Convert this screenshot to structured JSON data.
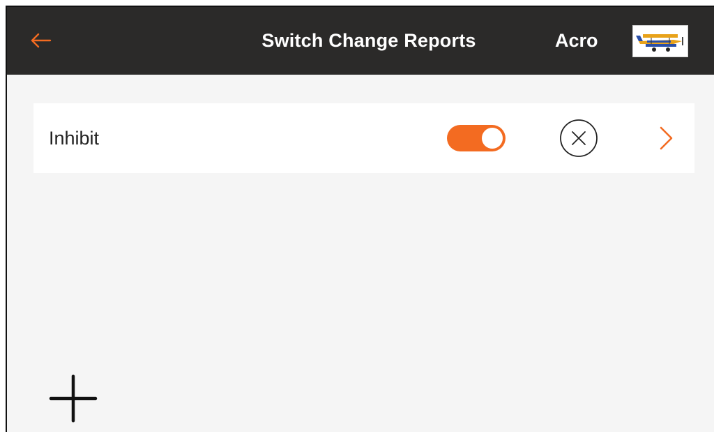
{
  "header": {
    "back_icon": "arrow-left-icon",
    "title": "Switch Change Reports",
    "model_name": "Acro",
    "model_thumbnail_icon": "airplane-thumbnail-icon"
  },
  "rows": [
    {
      "label": "Inhibit",
      "toggle_on": true,
      "clear_icon": "circle-x-icon",
      "chevron_icon": "chevron-right-icon"
    }
  ],
  "footer": {
    "add_icon": "plus-icon"
  },
  "colors": {
    "accent": "#f36b21",
    "header_bg": "#2b2a29",
    "page_bg": "#f5f5f5",
    "row_bg": "#ffffff"
  }
}
